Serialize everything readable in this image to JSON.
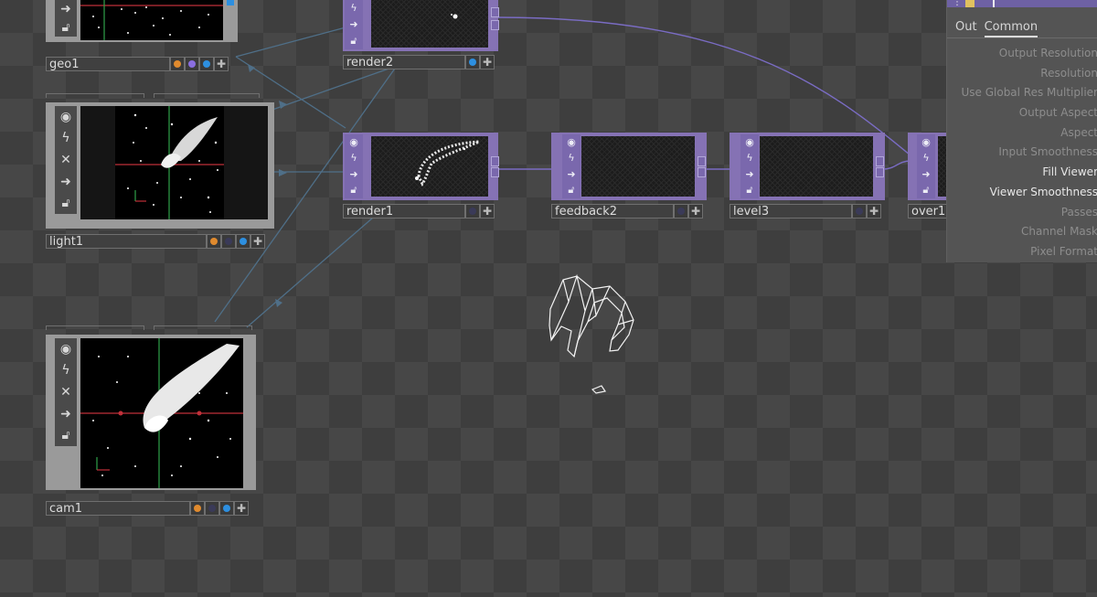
{
  "nodes": {
    "geo1": {
      "name": "geo1",
      "flags": [
        "orange",
        "purple",
        "blue"
      ]
    },
    "light1": {
      "name": "light1",
      "flags": [
        "orange",
        "dark",
        "blue"
      ]
    },
    "cam1": {
      "name": "cam1",
      "flags": [
        "orange",
        "dark",
        "blue"
      ]
    },
    "render2": {
      "name": "render2",
      "flags": [
        "blue"
      ]
    },
    "render1": {
      "name": "render1",
      "flags": [
        "dark"
      ]
    },
    "feedback2": {
      "name": "feedback2",
      "flags": [
        "dark"
      ]
    },
    "level3": {
      "name": "level3",
      "flags": [
        "dark"
      ]
    },
    "over1": {
      "name": "over1"
    }
  },
  "node_sidebar_icons": [
    "viewer-toggle-icon",
    "lightning-icon",
    "bypass-x-icon",
    "arrow-right-icon",
    "lock-icon"
  ],
  "parameter_panel": {
    "tabs": [
      "Out",
      "Common"
    ],
    "active_tab": "Common",
    "params": [
      {
        "label": "Output Resolution",
        "enabled": false
      },
      {
        "label": "Resolution",
        "enabled": false
      },
      {
        "label": "Use Global Res Multiplier",
        "enabled": false
      },
      {
        "label": "Output Aspect",
        "enabled": false
      },
      {
        "label": "Aspect",
        "enabled": false
      },
      {
        "label": "Input Smoothness",
        "enabled": false
      },
      {
        "label": "Fill Viewer",
        "enabled": true
      },
      {
        "label": "Viewer Smoothness",
        "enabled": true
      },
      {
        "label": "Passes",
        "enabled": false
      },
      {
        "label": "Channel Mask",
        "enabled": false
      },
      {
        "label": "Pixel Format",
        "enabled": false
      }
    ]
  },
  "colors": {
    "background_dark": "#3e3e3e",
    "background_light": "#474747",
    "comp_node_frame": "#9a9a9a",
    "top_node_frame": "#8572b4",
    "flag_orange": "#e08a2e",
    "flag_purple": "#8a6ee0",
    "flag_blue": "#2d8fe0",
    "flag_dark": "#3a3a58",
    "wire_blue": "#4f6f88",
    "wire_purple": "#7a6cc4",
    "panel_bg": "#545454"
  }
}
